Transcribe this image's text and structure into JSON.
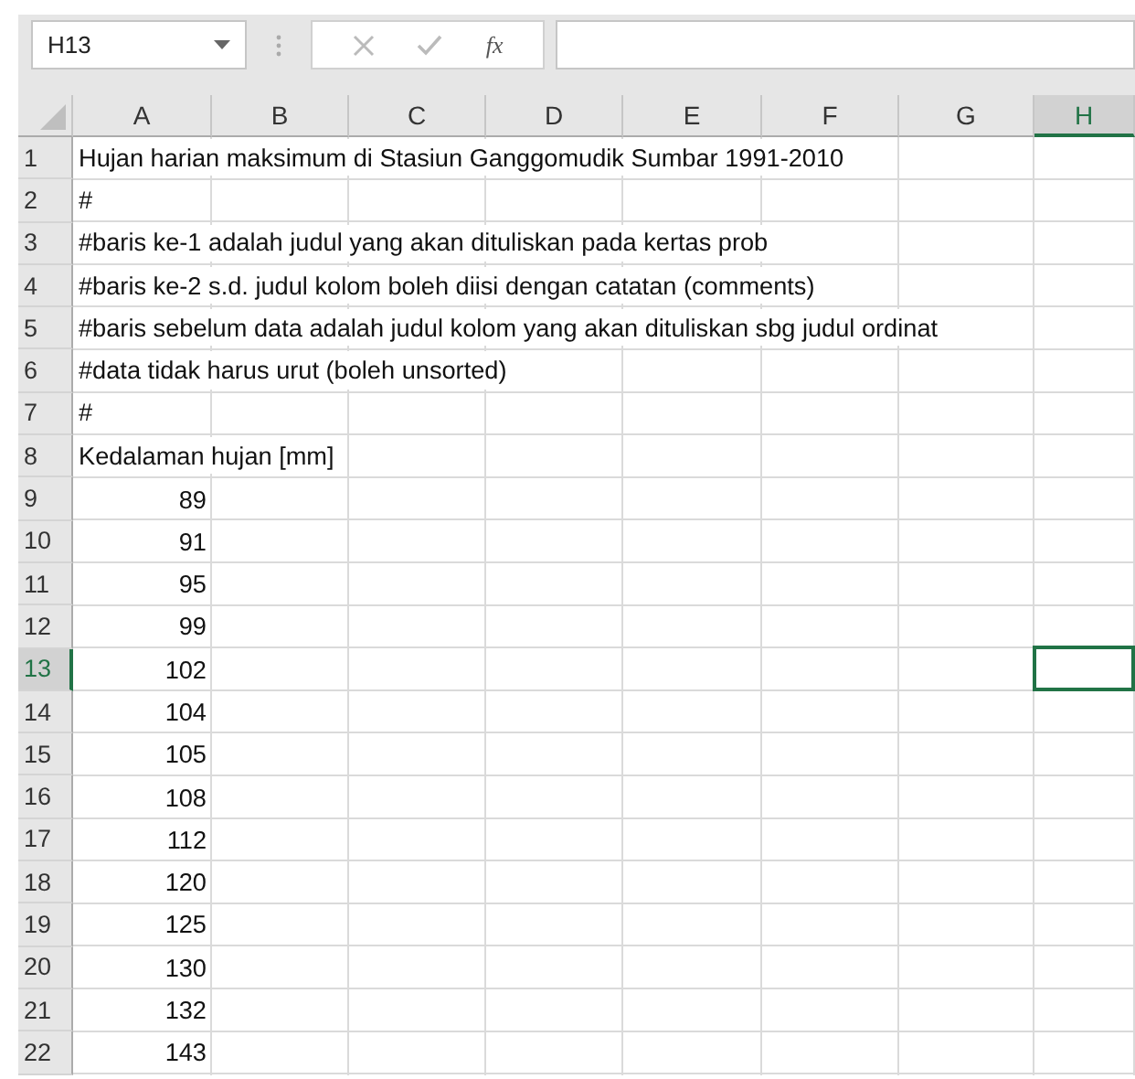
{
  "name_box": {
    "value": "H13"
  },
  "formula_bar": {
    "function_label": "fx"
  },
  "columns": [
    {
      "label": "A",
      "selected": false
    },
    {
      "label": "B",
      "selected": false
    },
    {
      "label": "C",
      "selected": false
    },
    {
      "label": "D",
      "selected": false
    },
    {
      "label": "E",
      "selected": false
    },
    {
      "label": "F",
      "selected": false
    },
    {
      "label": "G",
      "selected": false
    },
    {
      "label": "H",
      "selected": true
    }
  ],
  "rows": [
    {
      "label": "1",
      "selected": false,
      "cell": {
        "kind": "text",
        "value": "Hujan harian maksimum di Stasiun Ganggomudik Sumbar 1991-2010"
      }
    },
    {
      "label": "2",
      "selected": false,
      "cell": {
        "kind": "text",
        "value": "#"
      }
    },
    {
      "label": "3",
      "selected": false,
      "cell": {
        "kind": "text",
        "value": "#baris ke-1 adalah judul yang akan dituliskan pada kertas prob"
      }
    },
    {
      "label": "4",
      "selected": false,
      "cell": {
        "kind": "text",
        "value": "#baris ke-2 s.d. judul kolom boleh diisi dengan catatan (comments)"
      }
    },
    {
      "label": "5",
      "selected": false,
      "cell": {
        "kind": "text",
        "value": "#baris sebelum data adalah judul kolom yang akan dituliskan sbg judul ordinat"
      }
    },
    {
      "label": "6",
      "selected": false,
      "cell": {
        "kind": "text",
        "value": "#data tidak harus urut (boleh unsorted)"
      }
    },
    {
      "label": "7",
      "selected": false,
      "cell": {
        "kind": "text",
        "value": "#"
      }
    },
    {
      "label": "8",
      "selected": false,
      "cell": {
        "kind": "text",
        "value": "Kedalaman hujan [mm]"
      }
    },
    {
      "label": "9",
      "selected": false,
      "cell": {
        "kind": "number",
        "value": "89"
      }
    },
    {
      "label": "10",
      "selected": false,
      "cell": {
        "kind": "number",
        "value": "91"
      }
    },
    {
      "label": "11",
      "selected": false,
      "cell": {
        "kind": "number",
        "value": "95"
      }
    },
    {
      "label": "12",
      "selected": false,
      "cell": {
        "kind": "number",
        "value": "99"
      }
    },
    {
      "label": "13",
      "selected": true,
      "cell": {
        "kind": "number",
        "value": "102"
      }
    },
    {
      "label": "14",
      "selected": false,
      "cell": {
        "kind": "number",
        "value": "104"
      }
    },
    {
      "label": "15",
      "selected": false,
      "cell": {
        "kind": "number",
        "value": "105"
      }
    },
    {
      "label": "16",
      "selected": false,
      "cell": {
        "kind": "number",
        "value": "108"
      }
    },
    {
      "label": "17",
      "selected": false,
      "cell": {
        "kind": "number",
        "value": "112"
      }
    },
    {
      "label": "18",
      "selected": false,
      "cell": {
        "kind": "number",
        "value": "120"
      }
    },
    {
      "label": "19",
      "selected": false,
      "cell": {
        "kind": "number",
        "value": "125"
      }
    },
    {
      "label": "20",
      "selected": false,
      "cell": {
        "kind": "number",
        "value": "130"
      }
    },
    {
      "label": "21",
      "selected": false,
      "cell": {
        "kind": "number",
        "value": "132"
      }
    },
    {
      "label": "22",
      "selected": false,
      "cell": {
        "kind": "number",
        "value": "143"
      }
    }
  ]
}
